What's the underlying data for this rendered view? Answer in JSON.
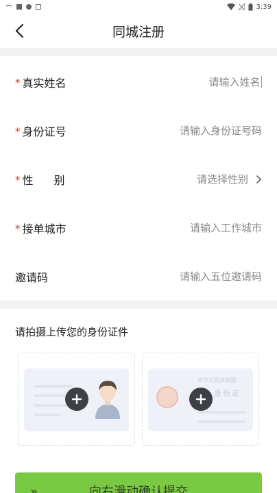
{
  "status_bar": {
    "time": "3:39"
  },
  "header": {
    "title": "同城注册"
  },
  "form": {
    "required_mark": "*",
    "name": {
      "label": "真实姓名",
      "placeholder": "请输入姓名"
    },
    "id_number": {
      "label": "身份证号",
      "placeholder": "请输入身份证号码"
    },
    "gender": {
      "label_1": "性",
      "label_2": "别",
      "placeholder": "请选择性别"
    },
    "city": {
      "label": "接单城市",
      "placeholder": "请输入工作城市"
    },
    "invite": {
      "label": "邀请码",
      "placeholder": "请输入五位邀请码"
    }
  },
  "upload": {
    "title": "请拍摄上传您的身份证件",
    "back_card_small": "中华人民共和国",
    "back_card_big": "身份证"
  },
  "submit": {
    "arrows": "»",
    "label": "向右滑动确认提交"
  },
  "colors": {
    "accent": "#7ac943",
    "required": "#e53935",
    "band": "#f3f3f3"
  }
}
